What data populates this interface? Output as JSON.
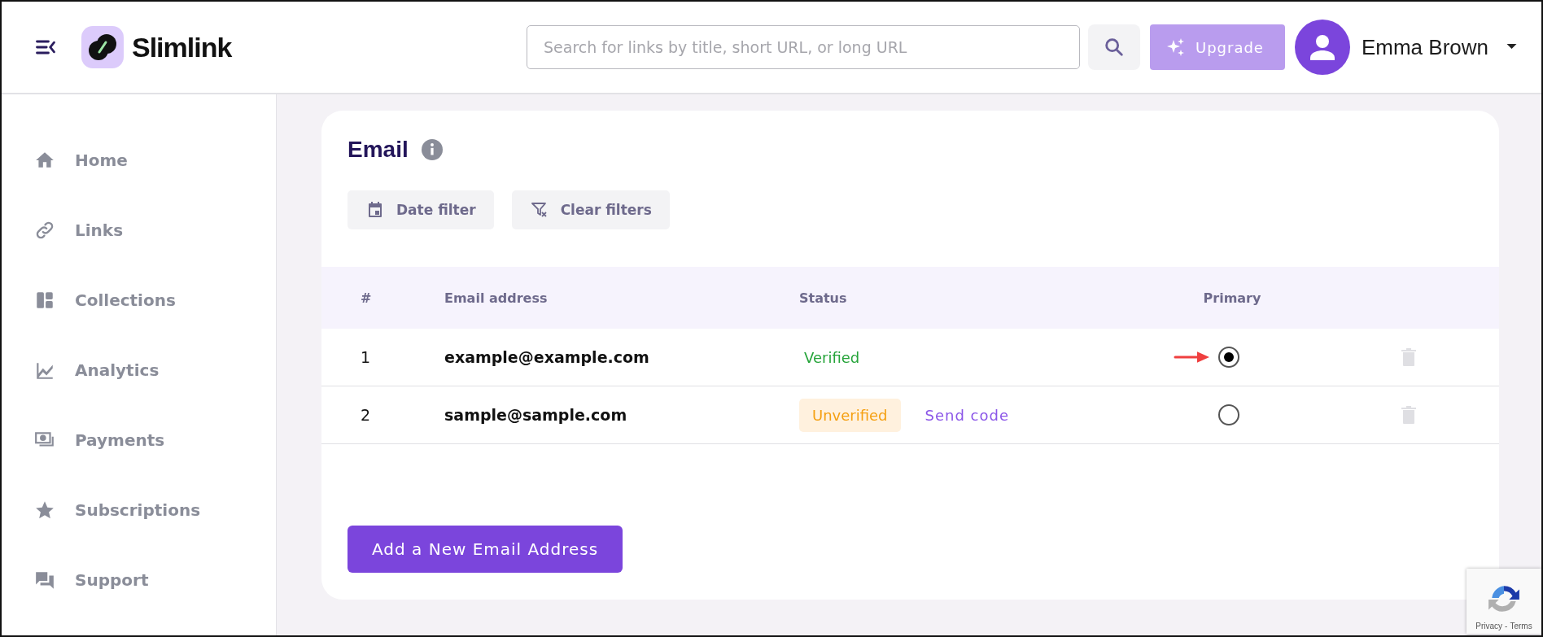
{
  "header": {
    "logo_text": "Slimlink",
    "search": {
      "placeholder": "Search for links by title, short URL, or long URL"
    },
    "upgrade_button": "Upgrade",
    "user_name": "Emma Brown"
  },
  "sidebar": {
    "items": [
      {
        "label": "Home",
        "kind": "home"
      },
      {
        "label": "Links",
        "kind": "link"
      },
      {
        "label": "Collections",
        "kind": "collections"
      },
      {
        "label": "Analytics",
        "kind": "analytics"
      },
      {
        "label": "Payments",
        "kind": "payments"
      },
      {
        "label": "Subscriptions",
        "kind": "star"
      },
      {
        "label": "Support",
        "kind": "support"
      }
    ]
  },
  "card": {
    "title": "Email",
    "filters": [
      {
        "label": "Date filter",
        "kind": "calendar"
      },
      {
        "label": "Clear filters",
        "kind": "filter-clear"
      }
    ],
    "table": {
      "columns": [
        "#",
        "Email address",
        "Status",
        "Primary"
      ],
      "rows": [
        {
          "number": "1",
          "email": "example@example.com",
          "status": {
            "label": "Verified",
            "kind": "verified"
          },
          "primary": {
            "selected": true
          },
          "annotated": true
        },
        {
          "number": "2",
          "email": "sample@sample.com",
          "status": {
            "label": "Unverified",
            "kind": "unverified"
          },
          "action": "Send code",
          "primary": {
            "selected": false
          },
          "annotated": false
        }
      ]
    },
    "add_button": "Add a New Email Address"
  },
  "recaptcha": {
    "privacy": "Privacy",
    "separator": "-",
    "terms": "Terms"
  }
}
